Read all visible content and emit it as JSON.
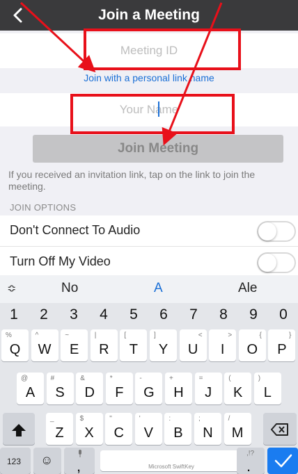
{
  "header": {
    "title": "Join a Meeting",
    "back_icon": "chevron-left-icon"
  },
  "meeting_id": {
    "placeholder": "Meeting ID",
    "value": ""
  },
  "personal_link": "Join with a personal link name",
  "your_name": {
    "placeholder": "Your Name",
    "value": ""
  },
  "join_button": "Join Meeting",
  "invite_text": "If you received an invitation link, tap on the link to join the meeting.",
  "join_options": {
    "label": "JOIN OPTIONS",
    "audio": {
      "label": "Don't Connect To Audio",
      "on": false
    },
    "video": {
      "label": "Turn Off My Video",
      "on": false
    }
  },
  "keyboard": {
    "expand": "≎",
    "suggestions": [
      "No",
      "A",
      "Ale"
    ],
    "numbers": [
      "1",
      "2",
      "3",
      "4",
      "5",
      "6",
      "7",
      "8",
      "9",
      "0"
    ],
    "row1": [
      {
        "k": "Q",
        "s": "%"
      },
      {
        "k": "W",
        "s": "^"
      },
      {
        "k": "E",
        "s": "~"
      },
      {
        "k": "R",
        "s": "|"
      },
      {
        "k": "T",
        "s": "["
      },
      {
        "k": "Y",
        "s": "]"
      },
      {
        "k": "U",
        "s": "<"
      },
      {
        "k": "I",
        "s": ">"
      },
      {
        "k": "O",
        "s": "{"
      },
      {
        "k": "P",
        "s": "}"
      }
    ],
    "row2": [
      {
        "k": "A",
        "s": "@"
      },
      {
        "k": "S",
        "s": "#"
      },
      {
        "k": "D",
        "s": "&"
      },
      {
        "k": "F",
        "s": "*"
      },
      {
        "k": "G",
        "s": "-"
      },
      {
        "k": "H",
        "s": "+"
      },
      {
        "k": "J",
        "s": "="
      },
      {
        "k": "K",
        "s": "("
      },
      {
        "k": "L",
        "s": ")"
      }
    ],
    "row3": [
      {
        "k": "Z",
        "s": "_"
      },
      {
        "k": "X",
        "s": "$"
      },
      {
        "k": "C",
        "s": "\""
      },
      {
        "k": "V",
        "s": "'"
      },
      {
        "k": "B",
        "s": ":"
      },
      {
        "k": "N",
        "s": ";"
      },
      {
        "k": "M",
        "s": "/"
      }
    ],
    "key_123": "123",
    "emoji": "☺",
    "comma": ",",
    "mic": "🎙",
    "space": "Microsoft SwiftKey",
    "period": ".",
    "period_sym": ",!?"
  },
  "colors": {
    "header": "#3a3a3c",
    "link": "#1a6fd6",
    "annotation": "#e8101a",
    "enter": "#1a7cf0"
  }
}
